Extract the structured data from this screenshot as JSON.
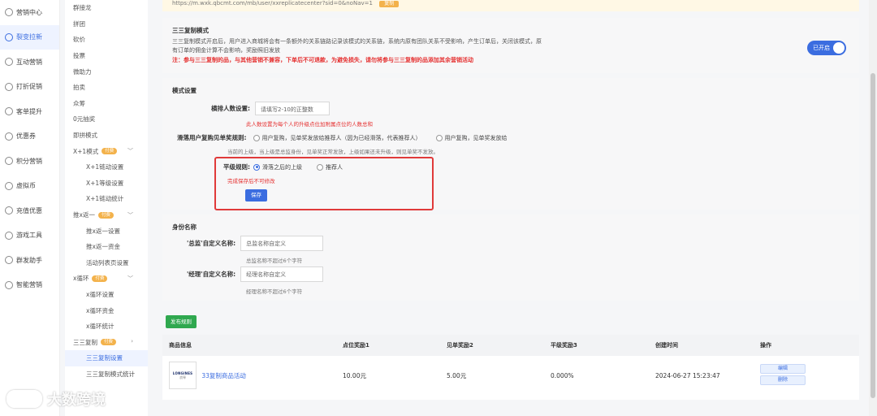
{
  "nav1": [
    {
      "label": "营销中心",
      "icon": "megaphone-icon"
    },
    {
      "label": "裂变拉新",
      "icon": "share-icon",
      "active": true
    },
    {
      "label": "互动营销",
      "icon": "interact-icon"
    },
    {
      "label": "打折促销",
      "icon": "discount-icon"
    },
    {
      "label": "客单提升",
      "icon": "cart-icon"
    },
    {
      "label": "优惠券",
      "icon": "coupon-icon"
    },
    {
      "label": "积分营销",
      "icon": "points-icon"
    },
    {
      "label": "虚拟币",
      "icon": "coin-icon"
    },
    {
      "label": "充值优惠",
      "icon": "recharge-icon"
    },
    {
      "label": "游戏工具",
      "icon": "game-icon"
    },
    {
      "label": "群发助手",
      "icon": "broadcast-icon"
    },
    {
      "label": "智能营销",
      "icon": "smart-icon"
    }
  ],
  "nav2": [
    {
      "label": "群接龙"
    },
    {
      "label": "拼团"
    },
    {
      "label": "砍价"
    },
    {
      "label": "投票"
    },
    {
      "label": "微助力"
    },
    {
      "label": "拍卖"
    },
    {
      "label": "众筹"
    },
    {
      "label": "0元抽奖"
    },
    {
      "label": "即拼模式"
    },
    {
      "label": "X+1模式",
      "tag": "付费",
      "chevron": "﹀"
    },
    {
      "label": "X+1链动设置",
      "child": true
    },
    {
      "label": "X+1等级设置",
      "child": true
    },
    {
      "label": "X+1链动统计",
      "child": true
    },
    {
      "label": "推x返一",
      "tag": "付费",
      "chevron": "﹀"
    },
    {
      "label": "推x返一设置",
      "child": true
    },
    {
      "label": "推x返一资金",
      "child": true
    },
    {
      "label": "活动列表页设置",
      "child": true
    },
    {
      "label": "x循环",
      "tag": "付费",
      "chevron": "﹀"
    },
    {
      "label": "x循环设置",
      "child": true
    },
    {
      "label": "x循环资金",
      "child": true
    },
    {
      "label": "x循环统计",
      "child": true
    },
    {
      "label": "三三复制",
      "tag": "付费",
      "chevron": "›"
    },
    {
      "label": "三三复制设置",
      "child": true,
      "active": true
    },
    {
      "label": "三三复制模式统计",
      "child": true
    }
  ],
  "urlbar": {
    "text": "https://m.wxk.qbcmt.com/mb/user/xxreplicatecenter?sid=0&noNav=1",
    "button": "复制"
  },
  "intro": {
    "title": "三三复制模式",
    "desc": "三三复制模式开启后，用户进入商城将会有一条额外的关系链路记录该模式的关系链，系统内原有团队关系不受影响，产生订单后，关闭该模式，原有订单的佣金计算不会影响，奖励照旧发放",
    "warn": "注：参与三三复制的品，与其他营销不兼容，下单后不可退款，为避免损失，请勿将参与三三复制的品添加其余营销活动",
    "toggle_label": "已开启"
  },
  "mode": {
    "title": "模式设置",
    "rank_label": "横排人数设置:",
    "rank_placeholder": "请填写2-10的正整数",
    "rank_hint": "此人数设置为每个人的升级点位加附属点位的人数总和",
    "slide_label": "滑落用户复购见单奖规则:",
    "slide_opt1": "用户复购，见单奖发放给推荐人（因为已经滑落，代表推荐人）",
    "slide_opt2": "用户复购，见单奖发放给",
    "slide_hint": "当前的上级，当上级是总监身份，见单奖正常发放，上级如果还未升级，则见单奖不发放。",
    "level_label": "平级规则:",
    "level_opt1": "滑落之后的上级",
    "level_opt2": "推荐人",
    "level_hint": "完成保存后不可修改",
    "save": "保存"
  },
  "identity": {
    "title": "身份名称",
    "director_label": "'总监'自定义名称:",
    "director_placeholder": "总监名称自定义",
    "director_hint": "总监名称不超过6个字符",
    "manager_label": "'经理'自定义名称:",
    "manager_placeholder": "经理名称自定义",
    "manager_hint": "经理名称不超过6个字符"
  },
  "publish": "发布规则",
  "table": {
    "headers": [
      "商品信息",
      "点位奖励1",
      "见单奖励2",
      "平级奖励3",
      "创建时间",
      "操作"
    ],
    "rows": [
      {
        "brand": "LONGINES",
        "brand_cn": "浪琴",
        "name": "33复制商品活动",
        "r1": "10.00元",
        "r2": "5.00元",
        "r3": "0.000%",
        "time": "2024-06-27 15:23:47",
        "edit": "编辑",
        "delete": "删除"
      }
    ]
  },
  "watermark": "大数跨境"
}
